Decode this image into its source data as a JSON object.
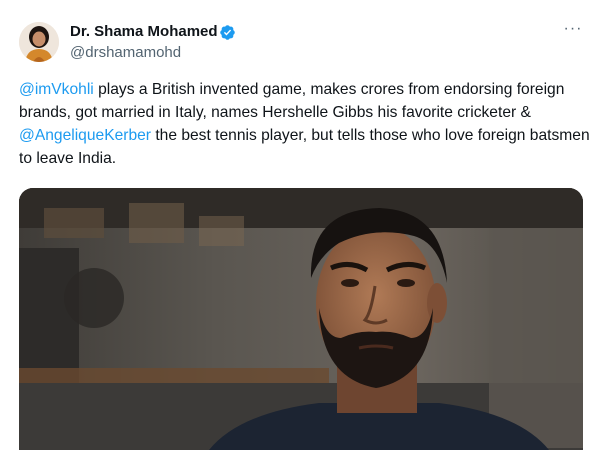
{
  "tweet": {
    "author": {
      "name": "Dr. Shama Mohamed",
      "handle": "@drshamamohd",
      "verified": true,
      "avatar_icon": "profile-photo"
    },
    "more_label": "···",
    "text_segments": [
      {
        "type": "mention",
        "text": "@imVkohli"
      },
      {
        "type": "text",
        "text": " plays a British invented game, makes crores from endorsing foreign brands, got married in Italy, names Hershelle Gibbs his favorite cricketer & "
      },
      {
        "type": "mention",
        "text": "@AngeliqueKerber"
      },
      {
        "type": "text",
        "text": " the best tennis player, but tells those who love foreign batsmen to leave India."
      }
    ],
    "media": {
      "type": "video-still",
      "description_icon": "man-portrait-photo"
    }
  },
  "colors": {
    "text": "#0f1419",
    "secondary": "#536471",
    "mention": "#1d9bf0",
    "verified": "#1d9bf0"
  }
}
